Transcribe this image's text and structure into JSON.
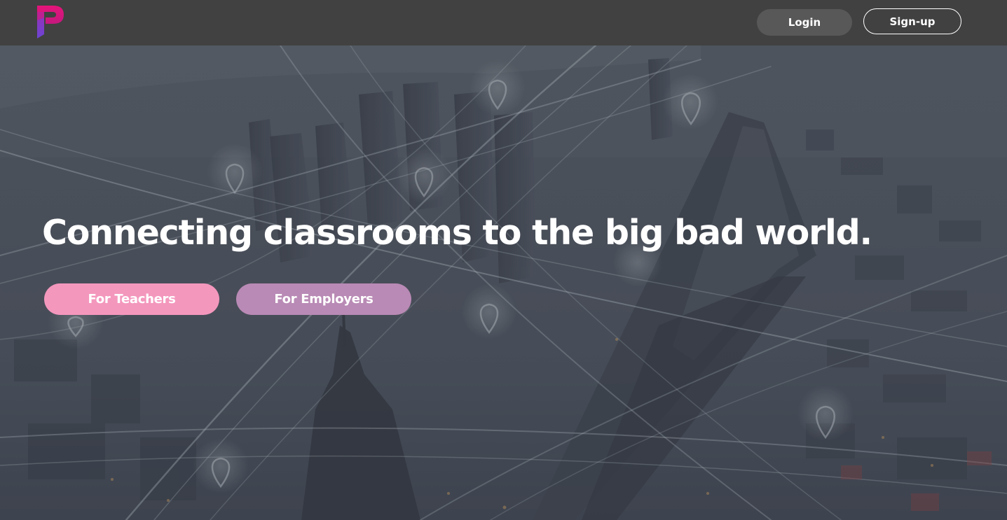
{
  "header": {
    "logo_icon": "brand-p-logo-icon",
    "login_label": "Login",
    "signup_label": "Sign-up"
  },
  "hero": {
    "headline": "Connecting classrooms to the big bad world.",
    "teachers_label": "For Teachers",
    "employers_label": "For Employers",
    "background": "aerial-city-network-image"
  },
  "colors": {
    "topbar": "#414141",
    "login_button": "#585858",
    "teachers_button": "#f497bd",
    "employers_button": "#b98ab5",
    "logo_magenta": "#e5147a",
    "logo_purple": "#7b3fc7"
  }
}
